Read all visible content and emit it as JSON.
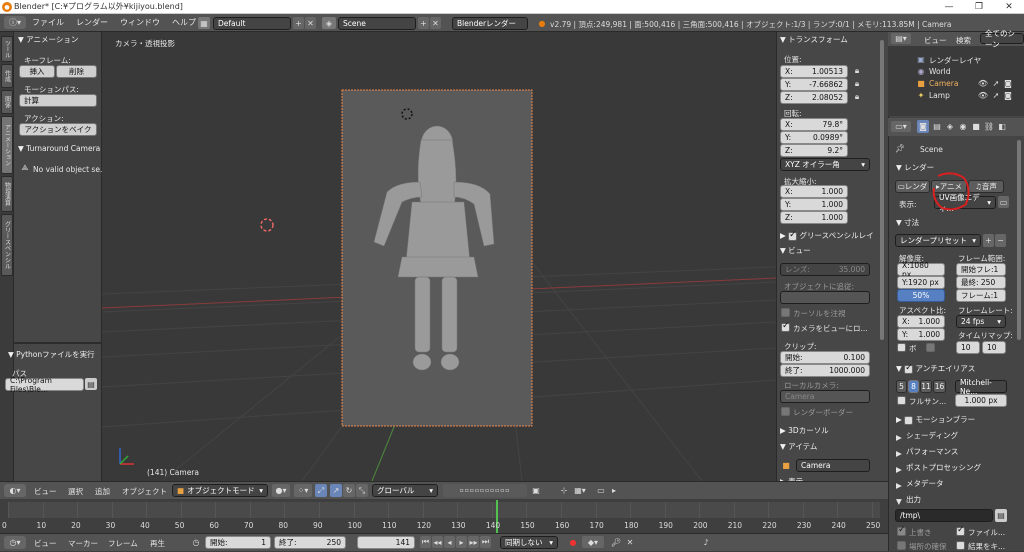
{
  "window": {
    "title": "Blender* [C:¥プログラム以外¥kijiyou.blend]",
    "minimize": "—",
    "restore": "❐",
    "close": "✕"
  },
  "topbar": {
    "menus": [
      "ファイル",
      "レンダー",
      "ウィンドウ",
      "ヘルプ"
    ],
    "layout": "Default",
    "scene": "Scene",
    "engine": "Blenderレンダー",
    "stats": "v2.79 | 頂点:249,981 | 面:500,416 | 三角面:500,416 | オブジェクト:1/3 | ランプ:0/1 | メモリ:113.85M | Camera"
  },
  "left_panel": {
    "tabs": [
      "ツール",
      "作成",
      "関係",
      "アニメーション",
      "物理演算",
      "グリースペンシル"
    ],
    "animation_header": "アニメーション",
    "keyframe_label": "キーフレーム:",
    "insert": "挿入",
    "delete": "削除",
    "motionpath_label": "モーションパス:",
    "calc": "計算",
    "action_label": "アクション:",
    "bake": "アクションをベイク",
    "turnaround_header": "Turnaround Camera",
    "no_valid": "No valid object se...",
    "python_header": "Pythonファイルを実行",
    "path_label": "パス",
    "path_value": "C:\\Program Files\\Ble..."
  },
  "viewport": {
    "label": "カメラ・透視投影",
    "object_label": "(141) Camera"
  },
  "properties_n": {
    "transform_header": "トランスフォーム",
    "location_label": "位置:",
    "loc": [
      {
        "axis": "X:",
        "value": "1.00513"
      },
      {
        "axis": "Y:",
        "value": "-7.66862"
      },
      {
        "axis": "Z:",
        "value": "2.08052"
      }
    ],
    "rotation_label": "回転:",
    "rot": [
      {
        "axis": "X:",
        "value": "79.8°"
      },
      {
        "axis": "Y:",
        "value": "0.0989°"
      },
      {
        "axis": "Z:",
        "value": "9.2°"
      }
    ],
    "rotation_mode": "XYZ オイラー角",
    "scale_label": "拡大縮小:",
    "scale": [
      {
        "axis": "X:",
        "value": "1.000"
      },
      {
        "axis": "Y:",
        "value": "1.000"
      },
      {
        "axis": "Z:",
        "value": "1.000"
      }
    ],
    "grease_header": "グリースペンシルレイ",
    "view_header": "ビュー",
    "lens": "レンズ:",
    "lens_value": "35.000",
    "lock_obj": "オブジェクトに追従:",
    "lock_cursor": "カーソルを注視",
    "lock_cam": "カメラをビューにロ...",
    "clip_label": "クリップ:",
    "clip_start": "開始:",
    "clip_start_value": "0.100",
    "clip_end": "終了:",
    "clip_end_value": "1000.000",
    "local_cam": "ローカルカメラ:",
    "local_cam_value": "Camera",
    "render_border": "レンダーボーダー",
    "cursor_header": "3Dカーソル",
    "item_header": "アイテム",
    "item_name": "Camera",
    "display_header": "表示"
  },
  "outliner": {
    "view": "ビュー",
    "search": "検索",
    "all": "全てのシーン",
    "items": [
      "レンダーレイヤ",
      "World",
      "Camera",
      "Lamp"
    ]
  },
  "properties": {
    "scene": "Scene",
    "render_header": "レンダー",
    "render_btn": "レンダ",
    "anim_btn": "アニメ",
    "audio_btn": "音声",
    "display_label": "表示:",
    "display_value": "UV画像エディ...",
    "dims_header": "寸法",
    "preset": "レンダープリセット",
    "res_label": "解像度:",
    "frame_range": "フレーム範囲:",
    "res_x": "X:1080 px",
    "res_y": "Y:1920 px",
    "res_pct": "50%",
    "start": "開始フレ:1",
    "end": "最終: 250",
    "step": "フレーム:1",
    "aspect": "アスペクト比:",
    "framerate": "フレームレート:",
    "asp_x": "1.000",
    "asp_y": "1.000",
    "fps": "24 fps",
    "border": "ボ",
    "time_remap": "タイムリマップ:",
    "remap_a": "10",
    "remap_b": "10",
    "aa_header": "アンチエイリアス",
    "aa_levels": [
      "5",
      "8",
      "11",
      "16"
    ],
    "aa_filter": "Mitchell-Ne...",
    "full_sample": "フルサン...",
    "filter_size": "1.000 px",
    "sections": [
      "モーションブラー",
      "シェーディング",
      "パフォーマンス",
      "ポストプロセッシング",
      "メタデータ",
      "出力"
    ],
    "output_path": "/tmp\\",
    "overwrite": "上書き",
    "file_ext": "ファイル...",
    "placeholders": "場所の確保",
    "cache": "結果をキ..."
  },
  "view_header": {
    "menus": [
      "ビュー",
      "選択",
      "追加",
      "オブジェクト"
    ],
    "mode": "オブジェクトモード",
    "orientation": "グローバル"
  },
  "timeline": {
    "ticks": [
      "0",
      "10",
      "20",
      "30",
      "40",
      "50",
      "60",
      "70",
      "80",
      "90",
      "100",
      "110",
      "120",
      "130",
      "140",
      "150",
      "160",
      "170",
      "180",
      "190",
      "200",
      "210",
      "220",
      "230",
      "240",
      "250"
    ],
    "current_frame": 141
  },
  "footer": {
    "menus": [
      "ビュー",
      "マーカー",
      "フレーム",
      "再生"
    ],
    "start": "開始:",
    "start_value": "1",
    "end": "終了:",
    "end_value": "250",
    "current": "141",
    "sync": "同期しない"
  }
}
